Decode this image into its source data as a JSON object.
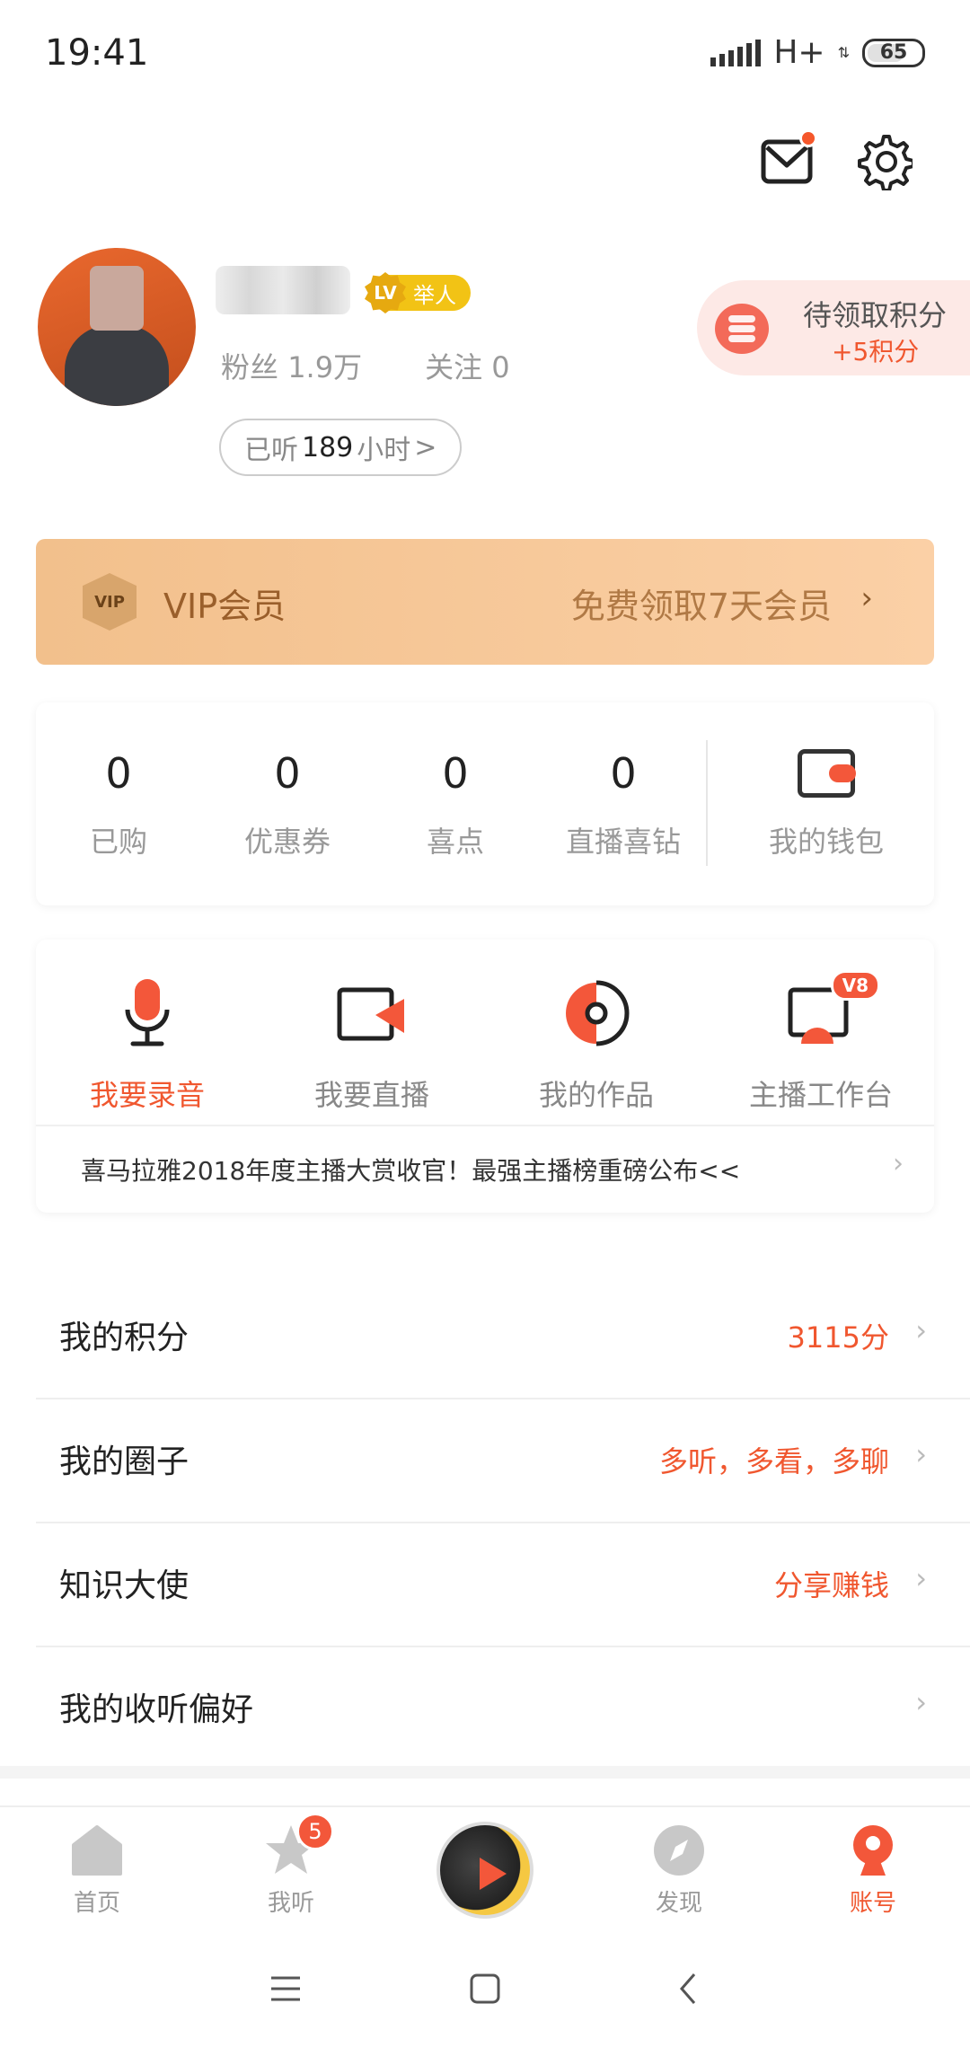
{
  "status_bar": {
    "time": "19:41",
    "network": "H+",
    "battery": "65"
  },
  "profile": {
    "level_badge": "LV",
    "level_title": "举人",
    "fans_label": "粉丝",
    "fans_value": "1.9万",
    "following_label": "关注",
    "following_value": "0",
    "listened_prefix": "已听",
    "listened_hours": "189",
    "listened_suffix": "小时",
    "listened_chevron": ">"
  },
  "points_card": {
    "title": "待领取积分",
    "subtitle": "+5积分"
  },
  "vip_banner": {
    "badge": "VIP",
    "title": "VIP会员",
    "subtitle": "免费领取7天会员",
    "chevron": "›"
  },
  "stats": [
    {
      "value": "0",
      "label": "已购"
    },
    {
      "value": "0",
      "label": "优惠券"
    },
    {
      "value": "0",
      "label": "喜点"
    },
    {
      "value": "0",
      "label": "直播喜钻"
    }
  ],
  "wallet": {
    "label": "我的钱包"
  },
  "creator": {
    "items": [
      {
        "label": "我要录音",
        "icon": "microphone-icon"
      },
      {
        "label": "我要直播",
        "icon": "video-camera-icon"
      },
      {
        "label": "我的作品",
        "icon": "disc-icon"
      },
      {
        "label": "主播工作台",
        "icon": "anchor-workbench-icon",
        "badge": "V8"
      }
    ],
    "news": "喜马拉雅2018年度主播大赏收官！最强主播榜重磅公布<<",
    "news_chevron": "›"
  },
  "list": [
    {
      "title": "我的积分",
      "value": "3115分"
    },
    {
      "title": "我的圈子",
      "value": "多听，多看，多聊"
    },
    {
      "title": "知识大使",
      "value": "分享赚钱"
    },
    {
      "title": "我的收听偏好",
      "value": ""
    }
  ],
  "list_chevron": "›",
  "bottom_nav": [
    {
      "label": "首页",
      "icon": "home-icon"
    },
    {
      "label": "我听",
      "icon": "star-icon",
      "badge": "5"
    },
    {
      "label": "发现",
      "icon": "compass-icon"
    },
    {
      "label": "账号",
      "icon": "account-icon"
    }
  ],
  "colors": {
    "accent": "#f0572f",
    "vip_gradient_start": "#f2c08c",
    "vip_gradient_end": "#fbd0a6",
    "points_bg": "#fde9e6"
  }
}
